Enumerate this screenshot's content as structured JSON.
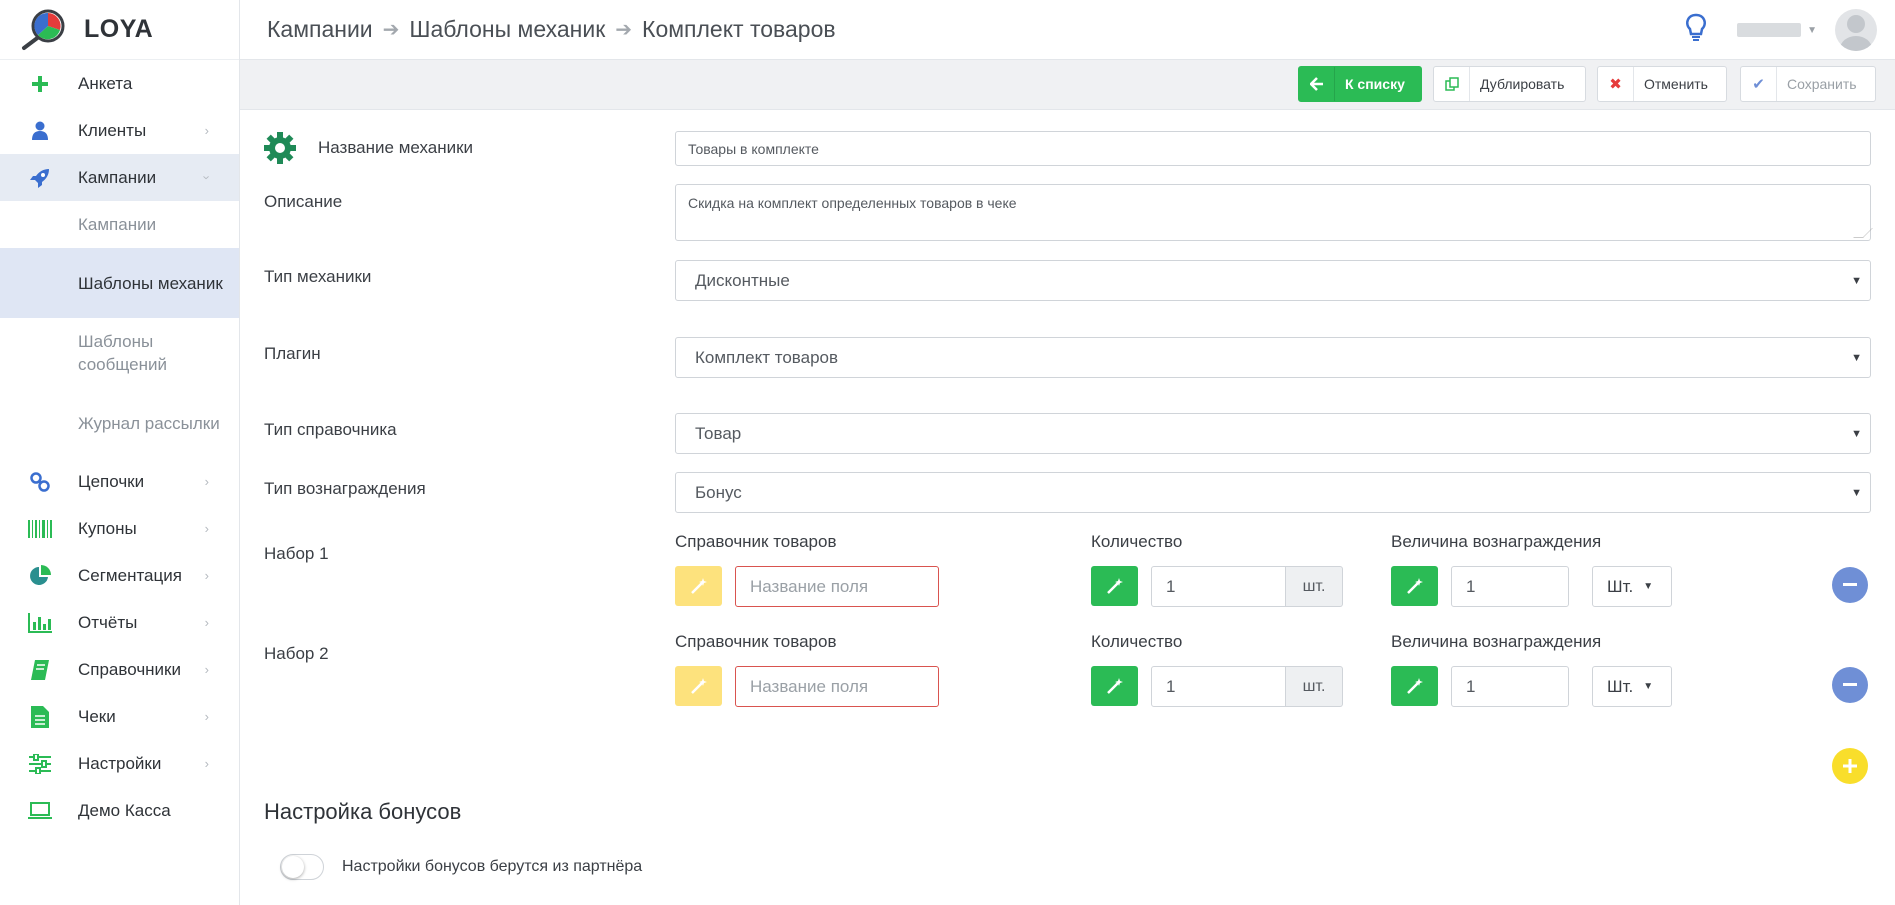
{
  "app": {
    "logo_text": "LOYA"
  },
  "sidebar": {
    "items": [
      {
        "label": "Анкета",
        "icon": "plus-icon",
        "color": "#2bbb55"
      },
      {
        "label": "Клиенты",
        "icon": "user-icon",
        "color": "#3a6ecf"
      },
      {
        "label": "Кампании",
        "icon": "rocket-icon",
        "color": "#3a6ecf"
      },
      {
        "label": "Цепочки",
        "icon": "chain-icon",
        "color": "#3a6ecf"
      },
      {
        "label": "Купоны",
        "icon": "barcode-icon",
        "color": "#2bbb55"
      },
      {
        "label": "Сегментация",
        "icon": "pie-chart-icon",
        "color": "#2a8f8f"
      },
      {
        "label": "Отчёты",
        "icon": "bar-chart-icon",
        "color": "#2bbb55"
      },
      {
        "label": "Справочники",
        "icon": "book-icon",
        "color": "#2bbb55"
      },
      {
        "label": "Чеки",
        "icon": "receipt-icon",
        "color": "#2bbb55"
      },
      {
        "label": "Настройки",
        "icon": "sliders-icon",
        "color": "#2bbb55"
      },
      {
        "label": "Демо Касса",
        "icon": "laptop-icon",
        "color": "#2bbb55"
      }
    ],
    "sub_items": [
      "Кампании",
      "Шаблоны механик",
      "Шаблоны сообщений",
      "Журнал рассылки"
    ]
  },
  "header": {
    "breadcrumbs": [
      "Кампании",
      "Шаблоны механик",
      "Комплект товаров"
    ]
  },
  "toolbar": {
    "back_label": "К списку",
    "duplicate_label": "Дублировать",
    "cancel_label": "Отменить",
    "save_label": "Сохранить"
  },
  "form": {
    "name_label": "Название механики",
    "name_value": "Товары в комплекте",
    "description_label": "Описание",
    "description_value": "Скидка на комплект определенных товаров в чеке",
    "type_label": "Тип механики",
    "type_value": "Дисконтные",
    "plugin_label": "Плагин",
    "plugin_value": "Комплект товаров",
    "ref_type_label": "Тип справочника",
    "ref_type_value": "Товар",
    "reward_type_label": "Тип вознаграждения",
    "reward_type_value": "Бонус"
  },
  "sets": [
    {
      "label": "Набор 1",
      "catalog_header": "Справочник товаров",
      "catalog_placeholder": "Название поля",
      "quantity_header": "Количество",
      "quantity_value": "1",
      "quantity_unit": "шт.",
      "reward_header": "Величина вознаграждения",
      "reward_value": "1",
      "reward_unit": "Шт."
    },
    {
      "label": "Набор 2",
      "catalog_header": "Справочник товаров",
      "catalog_placeholder": "Название поля",
      "quantity_header": "Количество",
      "quantity_value": "1",
      "quantity_unit": "шт.",
      "reward_header": "Величина вознаграждения",
      "reward_value": "1",
      "reward_unit": "Шт."
    }
  ],
  "bonus_settings": {
    "title": "Настройка бонусов",
    "toggle_label": "Настройки бонусов берутся из партнёра",
    "toggle_on": false
  },
  "colors": {
    "accent_green": "#2bbb55",
    "accent_yellow": "#fde27d",
    "accent_blue": "#6f8fd6",
    "error_red": "#d9534f"
  }
}
